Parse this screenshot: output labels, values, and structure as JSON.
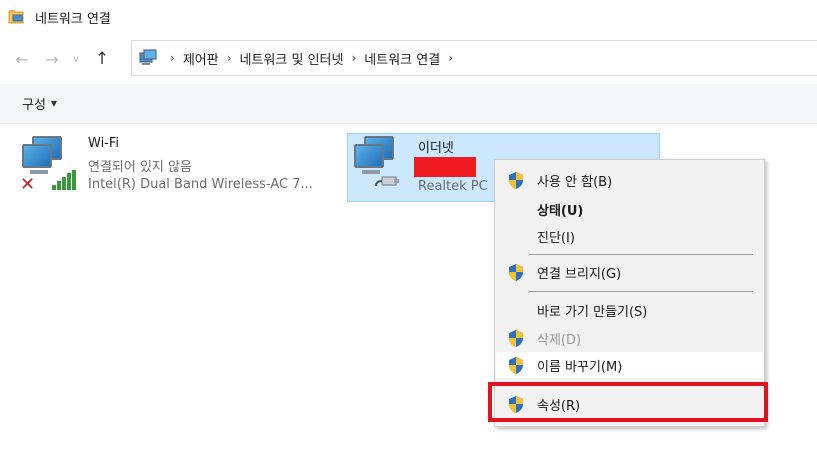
{
  "window": {
    "title": "네트워크 연결"
  },
  "nav": {
    "back": "←",
    "forward": "→",
    "recent": "∨",
    "up": "↑",
    "breadcrumb": [
      "제어판",
      "네트워크 및 인터넷",
      "네트워크 연결"
    ],
    "separator": "›"
  },
  "toolbar": {
    "organize_label": "구성",
    "organize_caret": "▼"
  },
  "connections": [
    {
      "name": "Wi-Fi",
      "status": "연결되어 있지 않음",
      "device": "Intel(R) Dual Band Wireless-AC 7...",
      "icon": "wifi-adapter-icon",
      "state_icon": "disconnected-x-icon",
      "selected": false
    },
    {
      "name": "이더넷",
      "status": "",
      "device": "Realtek PC",
      "icon": "ethernet-adapter-icon",
      "selected": true
    }
  ],
  "context_menu": {
    "items": [
      {
        "label": "사용 안 함(B)",
        "shield": true,
        "style": "normal"
      },
      {
        "label": "상태(U)",
        "shield": false,
        "style": "bold"
      },
      {
        "label": "진단(I)",
        "shield": false,
        "style": "normal"
      },
      {
        "label": "연결 브리지(G)",
        "shield": true,
        "style": "normal"
      },
      {
        "label": "바로 가기 만들기(S)",
        "shield": false,
        "style": "normal"
      },
      {
        "label": "삭제(D)",
        "shield": true,
        "style": "disabled"
      },
      {
        "label": "이름 바꾸기(M)",
        "shield": true,
        "style": "hover"
      },
      {
        "label": "속성(R)",
        "shield": true,
        "style": "normal"
      }
    ]
  },
  "colors": {
    "selection_bg": "#cce8ff",
    "selection_border": "#99d1ff",
    "highlight_box": "#e0141e",
    "redaction": "#ee1a22"
  }
}
